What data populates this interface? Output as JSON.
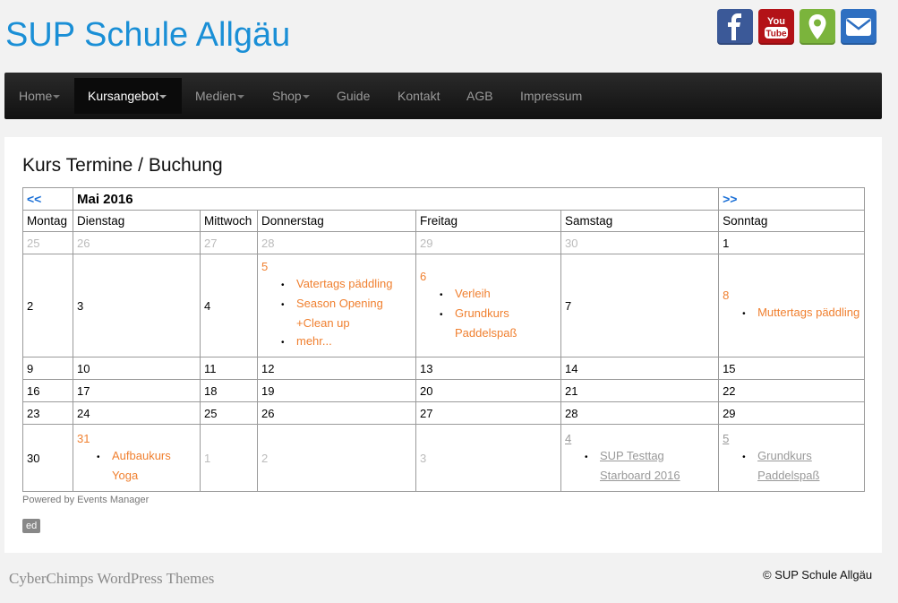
{
  "site": {
    "title": "SUP Schule Allgäu"
  },
  "social": {
    "facebook_icon": "facebook-icon",
    "youtube_icon": "youtube-icon",
    "map_icon": "map-marker-icon",
    "mail_icon": "envelope-icon",
    "youtube_text_top": "You",
    "youtube_text_bottom": "Tube"
  },
  "nav": {
    "items": [
      {
        "label": "Home",
        "dropdown": true
      },
      {
        "label": "Kursangebot",
        "dropdown": true,
        "active": true
      },
      {
        "label": "Medien",
        "dropdown": true
      },
      {
        "label": "Shop",
        "dropdown": true
      },
      {
        "label": "Guide",
        "dropdown": false
      },
      {
        "label": "Kontakt",
        "dropdown": false
      },
      {
        "label": "AGB",
        "dropdown": false
      },
      {
        "label": "Impressum",
        "dropdown": false
      }
    ]
  },
  "page": {
    "title": "Kurs Termine / Buchung"
  },
  "calendar": {
    "prev": "<<",
    "next": ">>",
    "month_label": "Mai 2016",
    "weekdays": [
      "Montag",
      "Dienstag",
      "Mittwoch",
      "Donnerstag",
      "Freitag",
      "Samstag",
      "Sonntag"
    ],
    "week1": [
      "25",
      "26",
      "27",
      "28",
      "29",
      "30",
      "1"
    ],
    "week2": {
      "mon": "2",
      "tue": "3",
      "wed": "4",
      "thu": {
        "day": "5",
        "events": [
          "Vatertags päddling",
          "Season Opening +Clean up",
          "mehr..."
        ]
      },
      "fri": {
        "day": "6",
        "events": [
          "Verleih",
          "Grundkurs Paddelspaß"
        ]
      },
      "sat": "7",
      "sun": {
        "day": "8",
        "events": [
          "Muttertags päddling"
        ]
      }
    },
    "week3": [
      "9",
      "10",
      "11",
      "12",
      "13",
      "14",
      "15"
    ],
    "week4": [
      "16",
      "17",
      "18",
      "19",
      "20",
      "21",
      "22"
    ],
    "week5": [
      "23",
      "24",
      "25",
      "26",
      "27",
      "28",
      "29"
    ],
    "week6": {
      "mon": "30",
      "tue": {
        "day": "31",
        "events": [
          "Aufbaukurs Yoga"
        ]
      },
      "wed": "1",
      "thu": "2",
      "fri": "3",
      "sat": {
        "day": "4",
        "events": [
          "SUP Testtag Starboard 2016"
        ]
      },
      "sun": {
        "day": "5",
        "events": [
          "Grundkurs Paddelspaß"
        ]
      }
    },
    "bullet": "•"
  },
  "powered": "Powered by Events Manager",
  "edit_badge": "ed",
  "footer": {
    "left": "CyberChimps WordPress Themes",
    "right": "© SUP Schule Allgäu"
  },
  "colors": {
    "title_blue": "#1a8fd6",
    "event_orange": "#f08030",
    "facebook": "#3b5998",
    "youtube": "#b31217",
    "map": "#7bb43c",
    "mail": "#2e6fc1"
  }
}
